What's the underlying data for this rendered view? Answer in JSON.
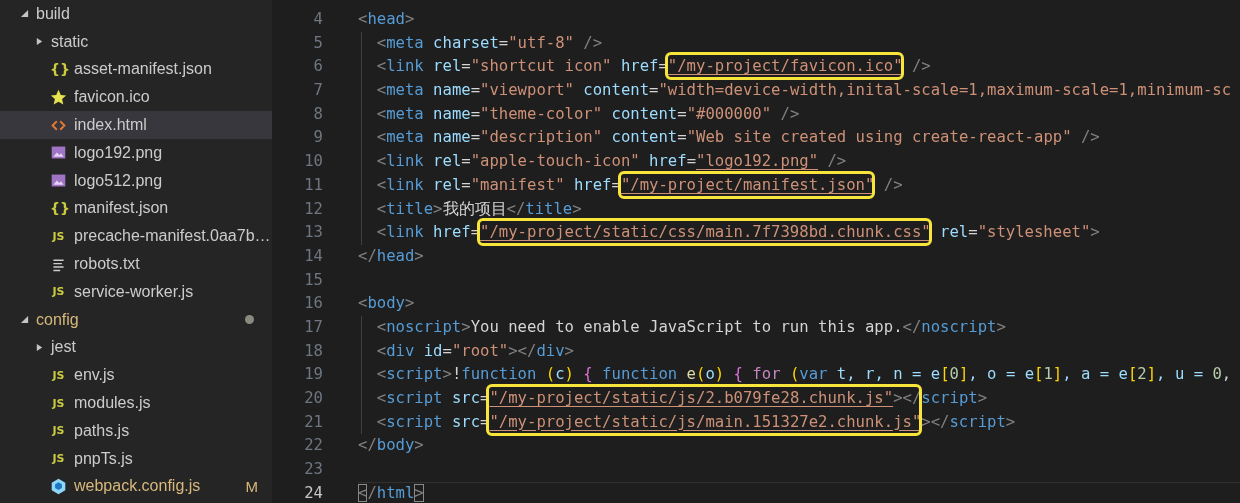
{
  "explorer": {
    "items": [
      {
        "label": "build",
        "kind": "folder",
        "expanded": true,
        "modified": false,
        "children": [
          {
            "label": "static",
            "kind": "folder",
            "expanded": false,
            "modified": false
          },
          {
            "label": "asset-manifest.json",
            "kind": "json",
            "icon_text": "{}",
            "modified": false,
            "selected": false
          },
          {
            "label": "favicon.ico",
            "kind": "favicon",
            "modified": false,
            "selected": false
          },
          {
            "label": "index.html",
            "kind": "html",
            "modified": false,
            "selected": true
          },
          {
            "label": "logo192.png",
            "kind": "image",
            "modified": false,
            "selected": false
          },
          {
            "label": "logo512.png",
            "kind": "image",
            "modified": false,
            "selected": false
          },
          {
            "label": "manifest.json",
            "kind": "json",
            "icon_text": "{}",
            "modified": false,
            "selected": false
          },
          {
            "label": "precache-manifest.0aa7b…",
            "kind": "js",
            "icon_text": "JS",
            "modified": false,
            "selected": false
          },
          {
            "label": "robots.txt",
            "kind": "text",
            "modified": false,
            "selected": false
          },
          {
            "label": "service-worker.js",
            "kind": "js",
            "icon_text": "JS",
            "modified": false,
            "selected": false
          }
        ]
      },
      {
        "label": "config",
        "kind": "folder",
        "expanded": true,
        "modified": true,
        "children": [
          {
            "label": "jest",
            "kind": "folder",
            "expanded": false,
            "modified": false
          },
          {
            "label": "env.js",
            "kind": "js",
            "icon_text": "JS",
            "modified": false,
            "selected": false
          },
          {
            "label": "modules.js",
            "kind": "js",
            "icon_text": "JS",
            "modified": false,
            "selected": false
          },
          {
            "label": "paths.js",
            "kind": "js",
            "icon_text": "JS",
            "modified": false,
            "selected": false
          },
          {
            "label": "pnpTs.js",
            "kind": "js",
            "icon_text": "JS",
            "modified": false,
            "selected": false
          },
          {
            "label": "webpack.config.js",
            "kind": "webpack",
            "modified": true,
            "badge": "M",
            "selected": false
          }
        ]
      }
    ]
  },
  "editor": {
    "lines": [
      {
        "number": "4",
        "indented": false,
        "current": false,
        "tokens": [
          {
            "text": "<",
            "kind": "punct"
          },
          {
            "text": "head",
            "kind": "tag"
          },
          {
            "text": ">",
            "kind": "punct"
          }
        ]
      },
      {
        "number": "5",
        "indented": true,
        "current": false,
        "tokens": [
          {
            "text": "<",
            "kind": "punct"
          },
          {
            "text": "meta",
            "kind": "tag"
          },
          {
            "text": " charset",
            "kind": "attr"
          },
          {
            "text": "=",
            "kind": "plain"
          },
          {
            "text": "\"utf-8\"",
            "kind": "str"
          },
          {
            "text": " />",
            "kind": "punct"
          }
        ]
      },
      {
        "number": "6",
        "indented": true,
        "current": false,
        "tokens": [
          {
            "text": "<",
            "kind": "punct"
          },
          {
            "text": "link",
            "kind": "tag"
          },
          {
            "text": " rel",
            "kind": "attr"
          },
          {
            "text": "=",
            "kind": "plain"
          },
          {
            "text": "\"shortcut icon\"",
            "kind": "str"
          },
          {
            "text": " href",
            "kind": "attr"
          },
          {
            "text": "=",
            "kind": "plain"
          },
          {
            "text": "\"/my-project/favicon.ico\"",
            "kind": "link",
            "boxed": true
          },
          {
            "text": " />",
            "kind": "punct"
          }
        ]
      },
      {
        "number": "7",
        "indented": true,
        "current": false,
        "tokens": [
          {
            "text": "<",
            "kind": "punct"
          },
          {
            "text": "meta",
            "kind": "tag"
          },
          {
            "text": " name",
            "kind": "attr"
          },
          {
            "text": "=",
            "kind": "plain"
          },
          {
            "text": "\"viewport\"",
            "kind": "str"
          },
          {
            "text": " content",
            "kind": "attr"
          },
          {
            "text": "=",
            "kind": "plain"
          },
          {
            "text": "\"width=device-width,inital-scale=1,maximum-scale=1,minimum-sc",
            "kind": "str"
          }
        ]
      },
      {
        "number": "8",
        "indented": true,
        "current": false,
        "tokens": [
          {
            "text": "<",
            "kind": "punct"
          },
          {
            "text": "meta",
            "kind": "tag"
          },
          {
            "text": " name",
            "kind": "attr"
          },
          {
            "text": "=",
            "kind": "plain"
          },
          {
            "text": "\"theme-color\"",
            "kind": "str"
          },
          {
            "text": " content",
            "kind": "attr"
          },
          {
            "text": "=",
            "kind": "plain"
          },
          {
            "text": "\"#000000\"",
            "kind": "str"
          },
          {
            "text": " />",
            "kind": "punct"
          }
        ]
      },
      {
        "number": "9",
        "indented": true,
        "current": false,
        "tokens": [
          {
            "text": "<",
            "kind": "punct"
          },
          {
            "text": "meta",
            "kind": "tag"
          },
          {
            "text": " name",
            "kind": "attr"
          },
          {
            "text": "=",
            "kind": "plain"
          },
          {
            "text": "\"description\"",
            "kind": "str"
          },
          {
            "text": " content",
            "kind": "attr"
          },
          {
            "text": "=",
            "kind": "plain"
          },
          {
            "text": "\"Web site created using create-react-app\"",
            "kind": "str"
          },
          {
            "text": " />",
            "kind": "punct"
          }
        ]
      },
      {
        "number": "10",
        "indented": true,
        "current": false,
        "tokens": [
          {
            "text": "<",
            "kind": "punct"
          },
          {
            "text": "link",
            "kind": "tag"
          },
          {
            "text": " rel",
            "kind": "attr"
          },
          {
            "text": "=",
            "kind": "plain"
          },
          {
            "text": "\"apple-touch-icon\"",
            "kind": "str"
          },
          {
            "text": " href",
            "kind": "attr"
          },
          {
            "text": "=",
            "kind": "plain"
          },
          {
            "text": "\"logo192.png\"",
            "kind": "link"
          },
          {
            "text": " />",
            "kind": "punct"
          }
        ]
      },
      {
        "number": "11",
        "indented": true,
        "current": false,
        "tokens": [
          {
            "text": "<",
            "kind": "punct"
          },
          {
            "text": "link",
            "kind": "tag"
          },
          {
            "text": " rel",
            "kind": "attr"
          },
          {
            "text": "=",
            "kind": "plain"
          },
          {
            "text": "\"manifest\"",
            "kind": "str"
          },
          {
            "text": " href",
            "kind": "attr"
          },
          {
            "text": "=",
            "kind": "plain"
          },
          {
            "text": "\"/my-project/manifest.json\"",
            "kind": "link",
            "boxed": true
          },
          {
            "text": " />",
            "kind": "punct"
          }
        ]
      },
      {
        "number": "12",
        "indented": true,
        "current": false,
        "tokens": [
          {
            "text": "<",
            "kind": "punct"
          },
          {
            "text": "title",
            "kind": "tag"
          },
          {
            "text": ">",
            "kind": "punct"
          },
          {
            "text": "我的项目",
            "kind": "plain"
          },
          {
            "text": "</",
            "kind": "punct"
          },
          {
            "text": "title",
            "kind": "tag"
          },
          {
            "text": ">",
            "kind": "punct"
          }
        ]
      },
      {
        "number": "13",
        "indented": true,
        "current": false,
        "tokens": [
          {
            "text": "<",
            "kind": "punct"
          },
          {
            "text": "link",
            "kind": "tag"
          },
          {
            "text": " href",
            "kind": "attr"
          },
          {
            "text": "=",
            "kind": "plain"
          },
          {
            "text": "\"/my-project/static/css/main.7f7398bd.chunk.css\"",
            "kind": "link",
            "boxed": true
          },
          {
            "text": " rel",
            "kind": "attr"
          },
          {
            "text": "=",
            "kind": "plain"
          },
          {
            "text": "\"stylesheet\"",
            "kind": "str"
          },
          {
            "text": ">",
            "kind": "punct"
          }
        ]
      },
      {
        "number": "14",
        "indented": false,
        "current": false,
        "tokens": [
          {
            "text": "</",
            "kind": "punct"
          },
          {
            "text": "head",
            "kind": "tag"
          },
          {
            "text": ">",
            "kind": "punct"
          }
        ]
      },
      {
        "number": "15",
        "current": false
      },
      {
        "number": "16",
        "indented": false,
        "current": false,
        "tokens": [
          {
            "text": "<",
            "kind": "punct"
          },
          {
            "text": "body",
            "kind": "tag"
          },
          {
            "text": ">",
            "kind": "punct"
          }
        ]
      },
      {
        "number": "17",
        "indented": true,
        "current": false,
        "tokens": [
          {
            "text": "<",
            "kind": "punct"
          },
          {
            "text": "noscript",
            "kind": "tag"
          },
          {
            "text": ">",
            "kind": "punct"
          },
          {
            "text": "You need to enable JavaScript to run this app.",
            "kind": "plain"
          },
          {
            "text": "</",
            "kind": "punct"
          },
          {
            "text": "noscript",
            "kind": "tag"
          },
          {
            "text": ">",
            "kind": "punct"
          }
        ]
      },
      {
        "number": "18",
        "indented": true,
        "current": false,
        "tokens": [
          {
            "text": "<",
            "kind": "punct"
          },
          {
            "text": "div",
            "kind": "tag"
          },
          {
            "text": " id",
            "kind": "attr"
          },
          {
            "text": "=",
            "kind": "plain"
          },
          {
            "text": "\"root\"",
            "kind": "str"
          },
          {
            "text": "></",
            "kind": "punct"
          },
          {
            "text": "div",
            "kind": "tag"
          },
          {
            "text": ">",
            "kind": "punct"
          }
        ]
      },
      {
        "number": "19",
        "indented": true,
        "current": false,
        "tokens": [
          {
            "text": "<",
            "kind": "punct"
          },
          {
            "text": "script",
            "kind": "tag"
          },
          {
            "text": ">",
            "kind": "punct"
          },
          {
            "text": "!",
            "kind": "plain"
          },
          {
            "text": "function",
            "kind": "keyword"
          },
          {
            "text": " (",
            "kind": "bracket"
          },
          {
            "text": "c",
            "kind": "var"
          },
          {
            "text": ")",
            "kind": "bracket"
          },
          {
            "text": " {",
            "kind": "brace"
          },
          {
            "text": " function",
            "kind": "keyword"
          },
          {
            "text": " e",
            "kind": "func"
          },
          {
            "text": "(",
            "kind": "bracket"
          },
          {
            "text": "o",
            "kind": "var"
          },
          {
            "text": ")",
            "kind": "bracket"
          },
          {
            "text": " {",
            "kind": "brace"
          },
          {
            "text": " for",
            "kind": "control"
          },
          {
            "text": " (",
            "kind": "bracket"
          },
          {
            "text": "var",
            "kind": "keyword"
          },
          {
            "text": " t, r, n = e",
            "kind": "var"
          },
          {
            "text": "[",
            "kind": "bracket"
          },
          {
            "text": "0",
            "kind": "num"
          },
          {
            "text": "]",
            "kind": "bracket"
          },
          {
            "text": ", o = e",
            "kind": "var"
          },
          {
            "text": "[",
            "kind": "bracket"
          },
          {
            "text": "1",
            "kind": "num"
          },
          {
            "text": "]",
            "kind": "bracket"
          },
          {
            "text": ", a = e",
            "kind": "var"
          },
          {
            "text": "[",
            "kind": "bracket"
          },
          {
            "text": "2",
            "kind": "num"
          },
          {
            "text": "]",
            "kind": "bracket"
          },
          {
            "text": ", u = ",
            "kind": "var"
          },
          {
            "text": "0",
            "kind": "num"
          },
          {
            "text": ",",
            "kind": "plain"
          }
        ]
      },
      {
        "number": "20",
        "indented": true,
        "current": false,
        "tokens": [
          {
            "text": "<",
            "kind": "punct"
          },
          {
            "text": "script",
            "kind": "tag"
          },
          {
            "text": " src",
            "kind": "attr"
          },
          {
            "text": "=",
            "kind": "plain"
          },
          {
            "text": "\"/my-project/static/js/2.b079fe28.chunk.js\"",
            "kind": "link",
            "boxed": true
          },
          {
            "text": "></",
            "kind": "punct"
          },
          {
            "text": "script",
            "kind": "tag"
          },
          {
            "text": ">",
            "kind": "punct"
          }
        ]
      },
      {
        "number": "21",
        "indented": true,
        "current": false,
        "tokens": [
          {
            "text": "<",
            "kind": "punct"
          },
          {
            "text": "script",
            "kind": "tag"
          },
          {
            "text": " src",
            "kind": "attr"
          },
          {
            "text": "=",
            "kind": "plain"
          },
          {
            "text": "\"/my-project/static/js/main.151327e2.chunk.js\"",
            "kind": "link",
            "boxed": true
          },
          {
            "text": "></",
            "kind": "punct"
          },
          {
            "text": "script",
            "kind": "tag"
          },
          {
            "text": ">",
            "kind": "punct"
          }
        ]
      },
      {
        "number": "22",
        "indented": false,
        "current": false,
        "tokens": [
          {
            "text": "</",
            "kind": "punct"
          },
          {
            "text": "body",
            "kind": "tag"
          },
          {
            "text": ">",
            "kind": "punct"
          }
        ]
      },
      {
        "number": "23",
        "current": false
      },
      {
        "number": "24",
        "indented": false,
        "current": true,
        "tokens": [
          {
            "text": "<",
            "kind": "punct",
            "matched": true
          },
          {
            "text": "/",
            "kind": "punct"
          },
          {
            "text": "html",
            "kind": "tag"
          },
          {
            "text": ">",
            "kind": "punct",
            "matched": true
          }
        ]
      }
    ]
  }
}
